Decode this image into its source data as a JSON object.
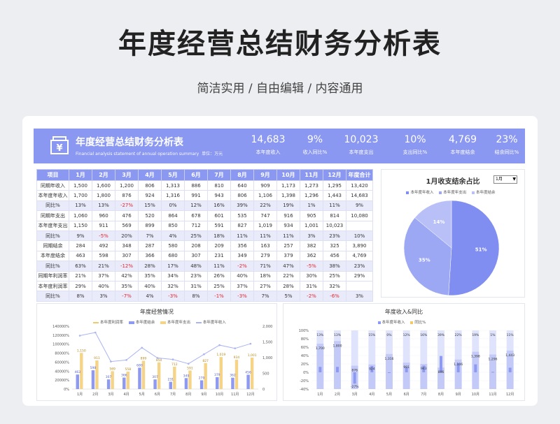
{
  "page": {
    "title": "年度经营总结财务分析表",
    "subtitle": "简洁实用 / 自由编辑 / 内容通用"
  },
  "banner": {
    "title": "年度经营总结财务分析表",
    "subtitle": "Financial analysis statement of annual operation summary",
    "unit": "单位：万元",
    "kpis": [
      {
        "value": "14,683",
        "label": "本年度收入"
      },
      {
        "value": "9%",
        "label": "收入同比%"
      },
      {
        "value": "10,023",
        "label": "本年度支出"
      },
      {
        "value": "10%",
        "label": "支出同比%"
      },
      {
        "value": "4,769",
        "label": "本年度结余"
      },
      {
        "value": "23%",
        "label": "结余同比%"
      }
    ]
  },
  "table": {
    "headers": [
      "项目",
      "1月",
      "2月",
      "3月",
      "4月",
      "5月",
      "6月",
      "7月",
      "8月",
      "9月",
      "10月",
      "11月",
      "12月",
      "年度合计"
    ],
    "rows": [
      {
        "label": "同期年收入",
        "type": "v",
        "cells": [
          "1,500",
          "1,600",
          "1,200",
          "806",
          "1,313",
          "886",
          "810",
          "640",
          "909",
          "1,173",
          "1,273",
          "1,295",
          "13,420"
        ]
      },
      {
        "label": "本年度年收入",
        "type": "v",
        "cells": [
          "1,700",
          "1,800",
          "876",
          "924",
          "1,316",
          "991",
          "943",
          "806",
          "1,106",
          "1,398",
          "1,296",
          "1,443",
          "14,683"
        ]
      },
      {
        "label": "同比%",
        "type": "r",
        "cells": [
          "13%",
          "13%",
          "-27%",
          "15%",
          "0%",
          "12%",
          "16%",
          "39%",
          "22%",
          "19%",
          "1%",
          "11%",
          "9%"
        ]
      },
      {
        "label": "同期年支出",
        "type": "v",
        "cells": [
          "1,060",
          "960",
          "476",
          "520",
          "864",
          "678",
          "601",
          "535",
          "747",
          "916",
          "905",
          "814",
          "10,080"
        ]
      },
      {
        "label": "本年度年支出",
        "type": "v",
        "cells": [
          "1,150",
          "911",
          "569",
          "899",
          "850",
          "712",
          "591",
          "827",
          "1,019",
          "934",
          "1,001",
          "10,023"
        ]
      },
      {
        "label": "同比%",
        "type": "r",
        "cells": [
          "9%",
          "-5%",
          "20%",
          "7%",
          "4%",
          "25%",
          "18%",
          "11%",
          "11%",
          "11%",
          "3%",
          "23%",
          "10%"
        ]
      },
      {
        "label": "同期结余",
        "type": "v",
        "cells": [
          "284",
          "492",
          "348",
          "287",
          "580",
          "208",
          "209",
          "356",
          "163",
          "257",
          "382",
          "325",
          "3,890"
        ]
      },
      {
        "label": "本年度结余",
        "type": "v",
        "cells": [
          "463",
          "598",
          "307",
          "366",
          "680",
          "307",
          "231",
          "349",
          "279",
          "379",
          "362",
          "456",
          "4,769"
        ]
      },
      {
        "label": "同比%",
        "type": "r",
        "cells": [
          "63%",
          "21%",
          "-12%",
          "28%",
          "17%",
          "48%",
          "11%",
          "-2%",
          "71%",
          "47%",
          "-5%",
          "38%",
          "23%"
        ]
      },
      {
        "label": "同期年利润率",
        "type": "v",
        "cells": [
          "21%",
          "37%",
          "42%",
          "35%",
          "34%",
          "23%",
          "26%",
          "40%",
          "18%",
          "22%",
          "30%",
          "25%",
          "29%"
        ]
      },
      {
        "label": "本年度利润率",
        "type": "v",
        "cells": [
          "29%",
          "40%",
          "35%",
          "40%",
          "32%",
          "31%",
          "25%",
          "37%",
          "27%",
          "28%",
          "31%",
          "32%"
        ]
      },
      {
        "label": "同比%",
        "type": "r",
        "cells": [
          "8%",
          "3%",
          "-7%",
          "4%",
          "-3%",
          "8%",
          "-1%",
          "-3%",
          "7%",
          "5%",
          "-2%",
          "-6%",
          "3%"
        ]
      }
    ]
  },
  "pie": {
    "title": "1月收支结余占比",
    "selected_month": "1月",
    "legend": [
      "本年度年收入",
      "本年度年支出",
      "本年度结余"
    ],
    "colors": [
      "#7f8ef0",
      "#9ca8f4",
      "#b8c0f7"
    ],
    "slices": [
      {
        "name": "本年度年收入",
        "value": 51
      },
      {
        "name": "本年度年支出",
        "value": 35
      },
      {
        "name": "本年度结余",
        "value": 14
      }
    ],
    "labels": [
      "51%",
      "35%",
      "14%"
    ]
  },
  "chart_data": [
    {
      "type": "bar",
      "title": "年度经营情况",
      "categories": [
        "1月",
        "2月",
        "3月",
        "4月",
        "5月",
        "6月",
        "7月",
        "8月",
        "9月",
        "10月",
        "11月",
        "12月"
      ],
      "legend": [
        "本年度利润率",
        "本年度结余",
        "本年度年支出",
        "本年度年收入"
      ],
      "y_ticks": [
        "0%",
        "20000%",
        "40000%",
        "60000%",
        "80000%",
        "100000%",
        "120000%",
        "140000%"
      ],
      "y2_ticks": [
        "0",
        "500",
        "1,000",
        "1,500",
        "2,000"
      ],
      "ylim": [
        0,
        140000
      ],
      "y2lim": [
        0,
        2000
      ],
      "series": [
        {
          "name": "本年度结余",
          "values": [
            463,
            598,
            307,
            366,
            680,
            307,
            231,
            349,
            279,
            379,
            362,
            456
          ]
        },
        {
          "name": "本年度年支出",
          "values": [
            1150,
            911,
            569,
            558,
            899,
            850,
            712,
            591,
            827,
            1019,
            934,
            1001
          ]
        },
        {
          "name": "本年度年收入",
          "values": [
            1700,
            1800,
            876,
            924,
            1316,
            991,
            943,
            806,
            1106,
            1398,
            1296,
            1443
          ]
        }
      ],
      "data_labels": {
        "本年度结余": [
          "463",
          "598",
          "307",
          "366",
          "680",
          "307",
          "231",
          "349",
          "279",
          "379",
          "362",
          "456"
        ],
        "本年度年支出": [
          "1,150",
          "911",
          "569",
          "558",
          "899",
          "850",
          "712",
          "591",
          "827",
          "1,019",
          "934",
          "1,001"
        ]
      }
    },
    {
      "type": "bar",
      "title": "年度收入&同比",
      "categories": [
        "1月",
        "2月",
        "3月",
        "4月",
        "5月",
        "6月",
        "7月",
        "8月",
        "9月",
        "10月",
        "11月",
        "12月"
      ],
      "legend": [
        "本年度年收入",
        "同比%"
      ],
      "y_ticks": [
        "-40%",
        "-20%",
        "0%",
        "20%",
        "40%",
        "60%",
        "80%",
        "100%"
      ],
      "ylim": [
        -40,
        100
      ],
      "series": [
        {
          "name": "本年度年收入",
          "values": [
            1700,
            1800,
            876,
            924,
            1316,
            991,
            943,
            806,
            1106,
            1398,
            1296,
            1443
          ]
        },
        {
          "name": "同比%",
          "values": [
            13,
            13,
            -27,
            15,
            0,
            12,
            16,
            39,
            22,
            19,
            1,
            11
          ]
        }
      ],
      "data_labels": {
        "同比%": [
          "13%",
          "13%",
          "-27%",
          "15%",
          "0%",
          "12%",
          "16%",
          "39%",
          "22%",
          "19%",
          "1%",
          "11%"
        ],
        "本年度年收入": [
          "1,700",
          "1,800",
          "876",
          "924",
          "1,316",
          "991",
          "943",
          "806",
          "1,106",
          "1,398",
          "1,296",
          "1,443"
        ]
      }
    }
  ]
}
